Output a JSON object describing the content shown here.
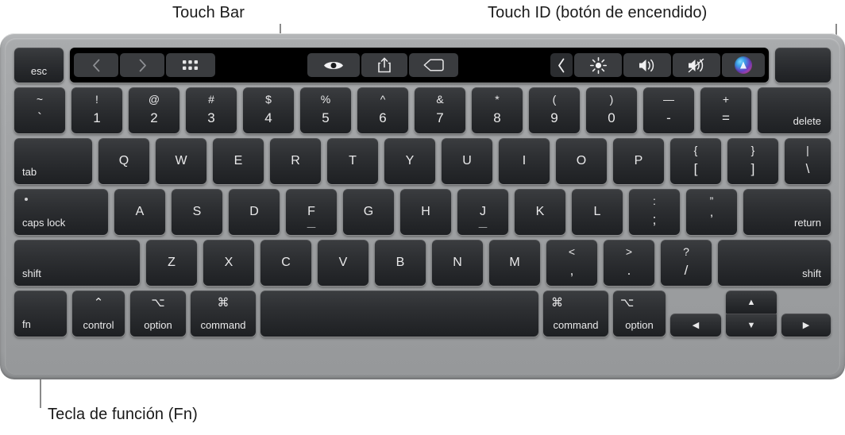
{
  "callouts": [
    {
      "id": "touchbar",
      "label": "Touch Bar"
    },
    {
      "id": "touchid",
      "label": "Touch ID (botón de encendido)"
    },
    {
      "id": "fn",
      "label": "Tecla de función (Fn)"
    }
  ],
  "colors": {
    "chassis": "#a0a2a4",
    "key_face": "#2e3033",
    "key_text": "#e9e9ea",
    "touchbar_bg": "#000000",
    "touchbar_btn": "#3a3c3f",
    "leader_line": "#8a8a8a",
    "caption_text": "#1a1a1a"
  },
  "device": {
    "name": "MacBook Pro keyboard",
    "layout": "US ANSI with Touch Bar"
  },
  "touchbar": {
    "label": "Touch Bar",
    "left_group": [
      {
        "name": "back-icon",
        "glyph": "chevron-left"
      },
      {
        "name": "forward-icon",
        "glyph": "chevron-right"
      },
      {
        "name": "grid-view-icon",
        "glyph": "grid"
      }
    ],
    "middle_group": [
      {
        "name": "quick-look-icon",
        "glyph": "eye"
      },
      {
        "name": "share-icon",
        "glyph": "share"
      },
      {
        "name": "tag-icon",
        "glyph": "tag"
      }
    ],
    "right_group": [
      {
        "name": "expand-control-strip-icon",
        "glyph": "chevron-left"
      },
      {
        "name": "brightness-icon",
        "glyph": "sun"
      },
      {
        "name": "volume-up-icon",
        "glyph": "speaker-waves"
      },
      {
        "name": "mute-icon",
        "glyph": "speaker-mute"
      },
      {
        "name": "siri-icon",
        "glyph": "siri-orb"
      }
    ]
  },
  "keys": {
    "esc": "esc",
    "touch_id": "",
    "delete": "delete",
    "tab": "tab",
    "caps_lock": "caps lock",
    "return": "return",
    "shift_left": "shift",
    "shift_right": "shift",
    "fn": "fn",
    "control": "control",
    "option_left": "option",
    "command_left": "command",
    "space": "",
    "command_right": "command",
    "option_right": "option",
    "symbols": {
      "control": "⌃",
      "option": "⌥",
      "command": "⌘"
    },
    "arrows": {
      "up": "▲",
      "down": "▼",
      "left": "◀",
      "right": "▶"
    },
    "number_row": [
      {
        "top": "~",
        "bot": "`"
      },
      {
        "top": "!",
        "bot": "1"
      },
      {
        "top": "@",
        "bot": "2"
      },
      {
        "top": "#",
        "bot": "3"
      },
      {
        "top": "$",
        "bot": "4"
      },
      {
        "top": "%",
        "bot": "5"
      },
      {
        "top": "^",
        "bot": "6"
      },
      {
        "top": "&",
        "bot": "7"
      },
      {
        "top": "*",
        "bot": "8"
      },
      {
        "top": "(",
        "bot": "9"
      },
      {
        "top": ")",
        "bot": "0"
      },
      {
        "top": "—",
        "bot": "-"
      },
      {
        "top": "+",
        "bot": "="
      }
    ],
    "qwerty_row": [
      "Q",
      "W",
      "E",
      "R",
      "T",
      "Y",
      "U",
      "I",
      "O",
      "P"
    ],
    "qwerty_row_extra": [
      {
        "top": "{",
        "bot": "["
      },
      {
        "top": "}",
        "bot": "]"
      },
      {
        "top": "|",
        "bot": "\\"
      }
    ],
    "asdf_row": [
      "A",
      "S",
      "D",
      "F",
      "G",
      "H",
      "J",
      "K",
      "L"
    ],
    "asdf_row_extra": [
      {
        "top": ":",
        "bot": ";"
      },
      {
        "top": "”",
        "bot": "’"
      }
    ],
    "zxcv_row": [
      "Z",
      "X",
      "C",
      "V",
      "B",
      "N",
      "M"
    ],
    "zxcv_row_extra": [
      {
        "top": "<",
        "bot": ","
      },
      {
        "top": ">",
        "bot": "."
      },
      {
        "top": "?",
        "bot": "/"
      }
    ],
    "home_bumps": [
      "F",
      "J"
    ]
  }
}
